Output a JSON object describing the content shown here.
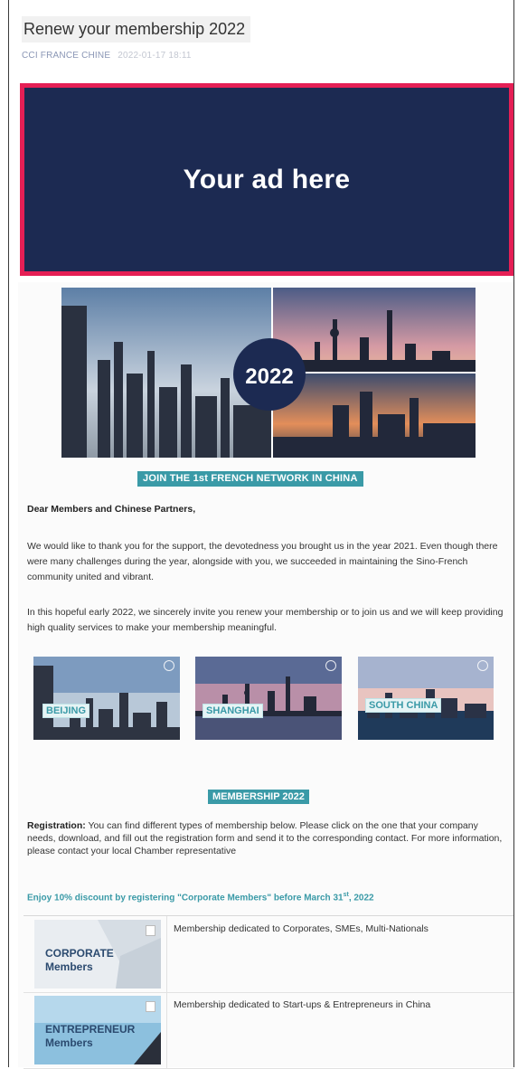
{
  "email": {
    "subject": "Renew your membership 2022",
    "sender": "CCI FRANCE CHINE",
    "timestamp": "2022-01-17 18:11"
  },
  "ad": {
    "text": "Your ad here"
  },
  "hero": {
    "year_badge": "2022"
  },
  "body": {
    "banner": "JOIN THE 1st FRENCH NETWORK IN CHINA",
    "salutation": "Dear Members and Chinese Partners,",
    "paragraph1": "We would like to thank you for the support, the devotedness you brought us in the year 2021. Even though there were many challenges during the year, alongside with you, we succeeded in maintaining the Sino-French community united and vibrant.",
    "paragraph2": "In this hopeful early 2022, we sincerely invite you renew your membership or to join us and we will keep providing high quality services to make your membership meaningful."
  },
  "cities": [
    {
      "label": "BEIJING"
    },
    {
      "label": "SHANGHAI"
    },
    {
      "label": "SOUTH CHINA"
    }
  ],
  "membership": {
    "banner": "MEMBERSHIP 2022",
    "registration_label": "Registration:",
    "registration_text": " You can find different types of membership below. Please click on the one that your company needs, download, and fill out the registration form and send it to the corresponding contact. For more information, please contact your local Chamber representative",
    "discount_text": "Enjoy 10% discount by registering \"Corporate Members\" before March 31",
    "discount_sup": "st",
    "discount_tail": ", 2022",
    "types": [
      {
        "title_line1": "CORPORATE",
        "title_line2": "Members",
        "description": "Membership dedicated to Corporates, SMEs, Multi-Nationals"
      },
      {
        "title_line1": "ENTREPRENEUR",
        "title_line2": "Members",
        "description": "Membership dedicated to Start-ups & Entrepreneurs in China"
      }
    ]
  }
}
